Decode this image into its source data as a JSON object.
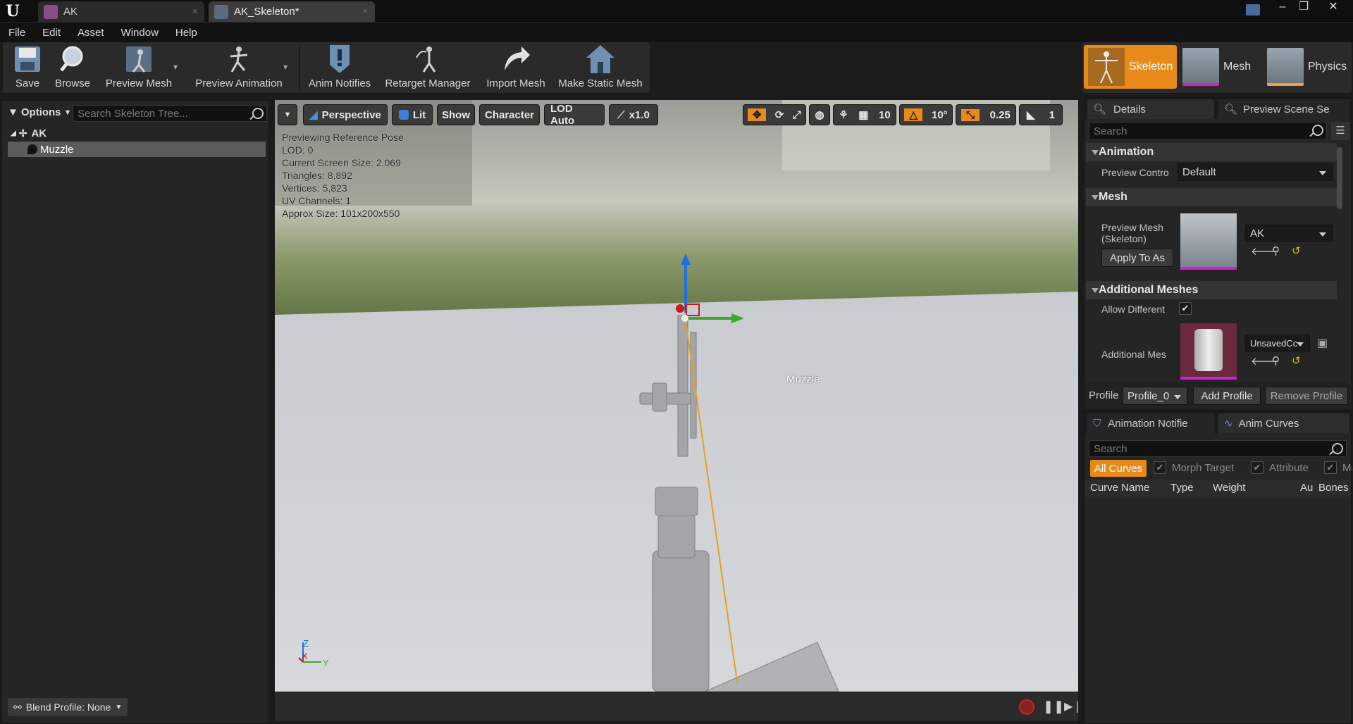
{
  "titlebar": {
    "tabs": [
      {
        "label": "AK"
      },
      {
        "label": "AK_Skeleton*"
      }
    ],
    "close_glyph": "×",
    "logo": "U"
  },
  "menubar": {
    "items": [
      "File",
      "Edit",
      "Asset",
      "Window",
      "Help"
    ]
  },
  "toolbar": {
    "save": "Save",
    "browse": "Browse",
    "preview_mesh": "Preview Mesh",
    "preview_animation": "Preview Animation",
    "anim_notifies": "Anim Notifies",
    "retarget_manager": "Retarget Manager",
    "import_mesh": "Import Mesh",
    "make_static_mesh": "Make Static Mesh"
  },
  "modes": {
    "skeleton": "Skeleton",
    "mesh": "Mesh",
    "physics": "Physics",
    "accent": "#e88a1a"
  },
  "skeleton_tree": {
    "options_label": "Options",
    "search_placeholder": "Search Skeleton Tree...",
    "root": "AK",
    "bones": [
      "Muzzle"
    ],
    "blend_profile": "Blend Profile: None"
  },
  "viewport": {
    "perspective": "Perspective",
    "lit": "Lit",
    "show": "Show",
    "character": "Character",
    "lod": "LOD Auto",
    "speed": "x1.0",
    "grid_snap": "10",
    "rot_snap": "10°",
    "scale_snap": "0.25",
    "camera_speed": "1",
    "info": [
      "Previewing Reference Pose",
      "LOD: 0",
      "Current Screen Size: 2.069",
      "Triangles: 8,892",
      "Vertices: 5,823",
      "UV Channels: 1",
      "Approx Size: 101x200x550"
    ],
    "bone_label": "Muzzle",
    "axis": {
      "z": "Z",
      "x": "X",
      "y": "Y"
    }
  },
  "details": {
    "tab_details": "Details",
    "tab_preview": "Preview Scene Se",
    "search_placeholder": "Search",
    "animation_header": "Animation",
    "preview_controller_label": "Preview Contro",
    "preview_controller_value": "Default",
    "mesh_header": "Mesh",
    "preview_mesh_label": "Preview Mesh (Skeleton)",
    "preview_mesh_value": "AK",
    "apply_button": "Apply To As",
    "additional_header": "Additional Meshes",
    "allow_different_label": "Allow Different",
    "additional_mesh_label": "Additional Mes",
    "additional_mesh_value": "UnsavedCc",
    "profile_label": "Profile",
    "profile_value": "Profile_0",
    "add_profile": "Add Profile",
    "remove_profile": "Remove Profile"
  },
  "curves": {
    "tab_notifies": "Animation Notifie",
    "tab_curves": "Anim Curves",
    "search_placeholder": "Search",
    "filters": [
      "All Curves",
      "Morph Target",
      "Attribute",
      "Mat"
    ],
    "columns": [
      "Curve Name",
      "Type",
      "Weight",
      "Au",
      "Bones"
    ]
  }
}
